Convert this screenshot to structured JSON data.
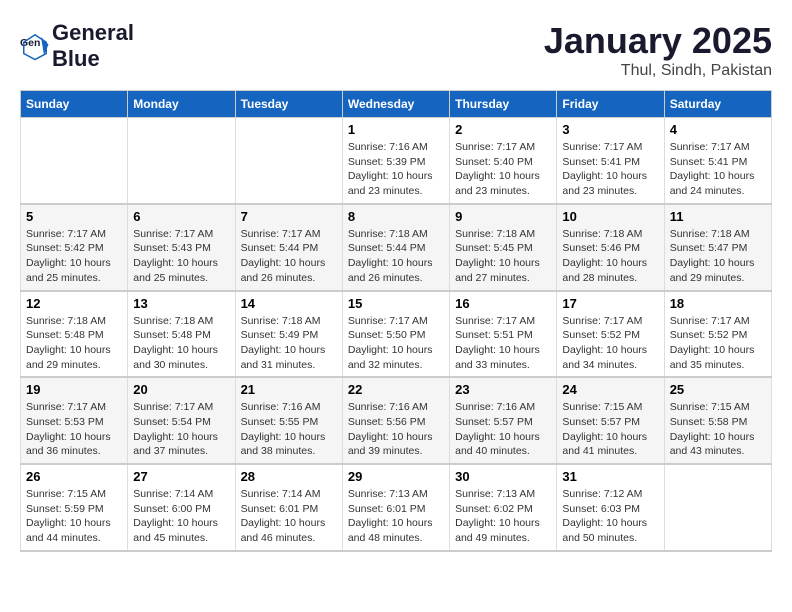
{
  "header": {
    "logo_general": "General",
    "logo_blue": "Blue",
    "month_title": "January 2025",
    "location": "Thul, Sindh, Pakistan"
  },
  "days_of_week": [
    "Sunday",
    "Monday",
    "Tuesday",
    "Wednesday",
    "Thursday",
    "Friday",
    "Saturday"
  ],
  "weeks": [
    [
      {
        "day": "",
        "info": ""
      },
      {
        "day": "",
        "info": ""
      },
      {
        "day": "",
        "info": ""
      },
      {
        "day": "1",
        "sunrise": "7:16 AM",
        "sunset": "5:39 PM",
        "daylight": "10 hours and 23 minutes."
      },
      {
        "day": "2",
        "sunrise": "7:17 AM",
        "sunset": "5:40 PM",
        "daylight": "10 hours and 23 minutes."
      },
      {
        "day": "3",
        "sunrise": "7:17 AM",
        "sunset": "5:41 PM",
        "daylight": "10 hours and 23 minutes."
      },
      {
        "day": "4",
        "sunrise": "7:17 AM",
        "sunset": "5:41 PM",
        "daylight": "10 hours and 24 minutes."
      }
    ],
    [
      {
        "day": "5",
        "sunrise": "7:17 AM",
        "sunset": "5:42 PM",
        "daylight": "10 hours and 25 minutes."
      },
      {
        "day": "6",
        "sunrise": "7:17 AM",
        "sunset": "5:43 PM",
        "daylight": "10 hours and 25 minutes."
      },
      {
        "day": "7",
        "sunrise": "7:17 AM",
        "sunset": "5:44 PM",
        "daylight": "10 hours and 26 minutes."
      },
      {
        "day": "8",
        "sunrise": "7:18 AM",
        "sunset": "5:44 PM",
        "daylight": "10 hours and 26 minutes."
      },
      {
        "day": "9",
        "sunrise": "7:18 AM",
        "sunset": "5:45 PM",
        "daylight": "10 hours and 27 minutes."
      },
      {
        "day": "10",
        "sunrise": "7:18 AM",
        "sunset": "5:46 PM",
        "daylight": "10 hours and 28 minutes."
      },
      {
        "day": "11",
        "sunrise": "7:18 AM",
        "sunset": "5:47 PM",
        "daylight": "10 hours and 29 minutes."
      }
    ],
    [
      {
        "day": "12",
        "sunrise": "7:18 AM",
        "sunset": "5:48 PM",
        "daylight": "10 hours and 29 minutes."
      },
      {
        "day": "13",
        "sunrise": "7:18 AM",
        "sunset": "5:48 PM",
        "daylight": "10 hours and 30 minutes."
      },
      {
        "day": "14",
        "sunrise": "7:18 AM",
        "sunset": "5:49 PM",
        "daylight": "10 hours and 31 minutes."
      },
      {
        "day": "15",
        "sunrise": "7:17 AM",
        "sunset": "5:50 PM",
        "daylight": "10 hours and 32 minutes."
      },
      {
        "day": "16",
        "sunrise": "7:17 AM",
        "sunset": "5:51 PM",
        "daylight": "10 hours and 33 minutes."
      },
      {
        "day": "17",
        "sunrise": "7:17 AM",
        "sunset": "5:52 PM",
        "daylight": "10 hours and 34 minutes."
      },
      {
        "day": "18",
        "sunrise": "7:17 AM",
        "sunset": "5:52 PM",
        "daylight": "10 hours and 35 minutes."
      }
    ],
    [
      {
        "day": "19",
        "sunrise": "7:17 AM",
        "sunset": "5:53 PM",
        "daylight": "10 hours and 36 minutes."
      },
      {
        "day": "20",
        "sunrise": "7:17 AM",
        "sunset": "5:54 PM",
        "daylight": "10 hours and 37 minutes."
      },
      {
        "day": "21",
        "sunrise": "7:16 AM",
        "sunset": "5:55 PM",
        "daylight": "10 hours and 38 minutes."
      },
      {
        "day": "22",
        "sunrise": "7:16 AM",
        "sunset": "5:56 PM",
        "daylight": "10 hours and 39 minutes."
      },
      {
        "day": "23",
        "sunrise": "7:16 AM",
        "sunset": "5:57 PM",
        "daylight": "10 hours and 40 minutes."
      },
      {
        "day": "24",
        "sunrise": "7:15 AM",
        "sunset": "5:57 PM",
        "daylight": "10 hours and 41 minutes."
      },
      {
        "day": "25",
        "sunrise": "7:15 AM",
        "sunset": "5:58 PM",
        "daylight": "10 hours and 43 minutes."
      }
    ],
    [
      {
        "day": "26",
        "sunrise": "7:15 AM",
        "sunset": "5:59 PM",
        "daylight": "10 hours and 44 minutes."
      },
      {
        "day": "27",
        "sunrise": "7:14 AM",
        "sunset": "6:00 PM",
        "daylight": "10 hours and 45 minutes."
      },
      {
        "day": "28",
        "sunrise": "7:14 AM",
        "sunset": "6:01 PM",
        "daylight": "10 hours and 46 minutes."
      },
      {
        "day": "29",
        "sunrise": "7:13 AM",
        "sunset": "6:01 PM",
        "daylight": "10 hours and 48 minutes."
      },
      {
        "day": "30",
        "sunrise": "7:13 AM",
        "sunset": "6:02 PM",
        "daylight": "10 hours and 49 minutes."
      },
      {
        "day": "31",
        "sunrise": "7:12 AM",
        "sunset": "6:03 PM",
        "daylight": "10 hours and 50 minutes."
      },
      {
        "day": "",
        "info": ""
      }
    ]
  ]
}
